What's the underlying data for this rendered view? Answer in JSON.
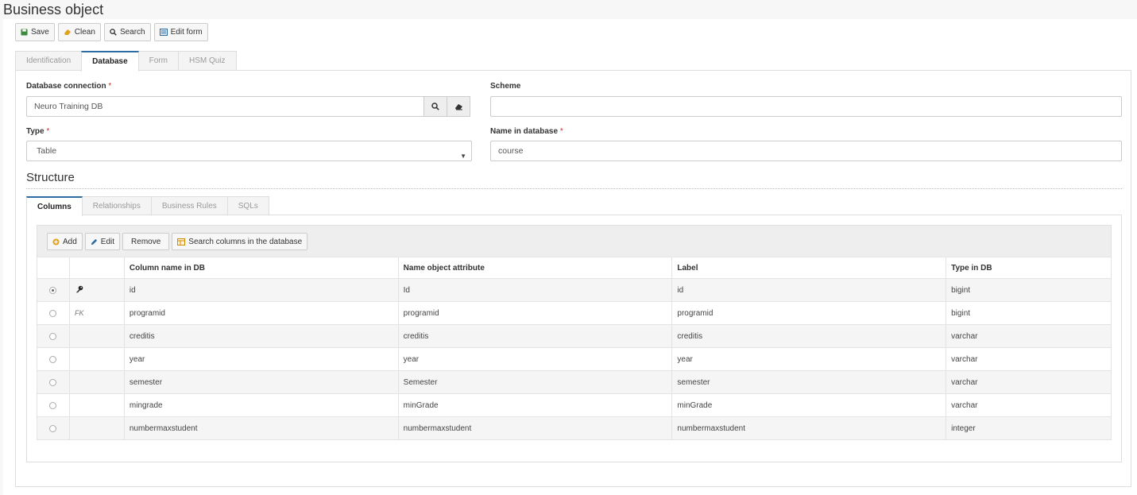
{
  "page_title": "Business object",
  "toolbar": {
    "save": "Save",
    "clean": "Clean",
    "search": "Search",
    "edit_form": "Edit form"
  },
  "tabs": [
    {
      "label": "Identification",
      "active": false
    },
    {
      "label": "Database",
      "active": true
    },
    {
      "label": "Form",
      "active": false
    },
    {
      "label": "HSM Quiz",
      "active": false
    }
  ],
  "form": {
    "db_connection": {
      "label": "Database connection",
      "required": "*",
      "value": "Neuro Training DB"
    },
    "scheme": {
      "label": "Scheme",
      "value": ""
    },
    "type": {
      "label": "Type",
      "required": "*",
      "value": "Table"
    },
    "name_in_db": {
      "label": "Name in database",
      "required": "*",
      "value": "course"
    }
  },
  "structure": {
    "title": "Structure",
    "subtabs": [
      {
        "label": "Columns",
        "active": true
      },
      {
        "label": "Relationships",
        "active": false
      },
      {
        "label": "Business Rules",
        "active": false
      },
      {
        "label": "SQLs",
        "active": false
      }
    ],
    "grid_toolbar": {
      "add": "Add",
      "edit": "Edit",
      "remove": "Remove",
      "search_columns": "Search columns in the database"
    },
    "columns": [
      "Column name in DB",
      "Name object attribute",
      "Label",
      "Type in DB"
    ],
    "rows": [
      {
        "selected": true,
        "key": "pk",
        "key_text": "",
        "column": "id",
        "attribute": "Id",
        "label": "id",
        "type": "bigint"
      },
      {
        "selected": false,
        "key": "fk",
        "key_text": "FK",
        "column": "programid",
        "attribute": "programid",
        "label": "programid",
        "type": "bigint"
      },
      {
        "selected": false,
        "key": "",
        "key_text": "",
        "column": "creditis",
        "attribute": "creditis",
        "label": "creditis",
        "type": "varchar"
      },
      {
        "selected": false,
        "key": "",
        "key_text": "",
        "column": "year",
        "attribute": "year",
        "label": "year",
        "type": "varchar"
      },
      {
        "selected": false,
        "key": "",
        "key_text": "",
        "column": "semester",
        "attribute": "Semester",
        "label": "semester",
        "type": "varchar"
      },
      {
        "selected": false,
        "key": "",
        "key_text": "",
        "column": "mingrade",
        "attribute": "minGrade",
        "label": "minGrade",
        "type": "varchar"
      },
      {
        "selected": false,
        "key": "",
        "key_text": "",
        "column": "numbermaxstudent",
        "attribute": "numbermaxstudent",
        "label": "numbermaxstudent",
        "type": "integer"
      }
    ]
  },
  "icons": {
    "save": "floppy-icon",
    "clean": "eraser-icon",
    "search": "magnifier-icon",
    "edit_form": "form-icon",
    "add": "plus-circle-icon",
    "edit": "pencil-icon",
    "search_columns": "table-icon",
    "primary_key": "key-icon"
  },
  "colors": {
    "accent": "#2d6ca2",
    "required": "#c9302c"
  }
}
